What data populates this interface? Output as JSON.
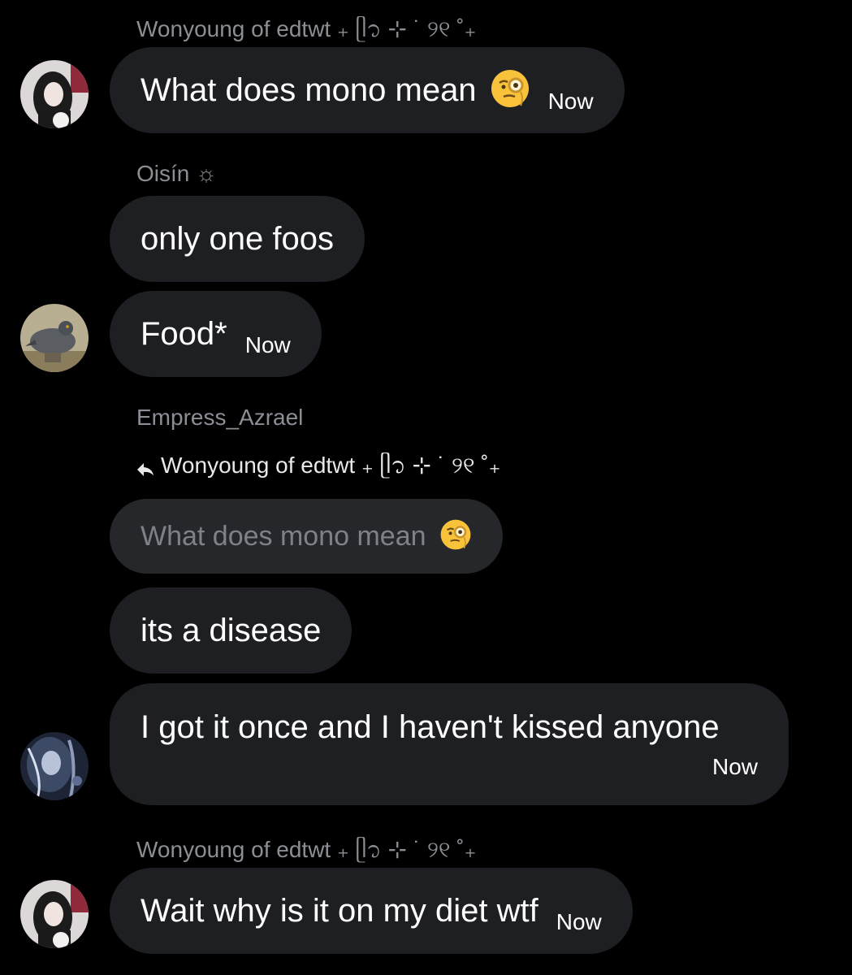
{
  "messages": [
    {
      "sender": "Wonyoung of edtwt ₊ ᥫ᭡ ⊹ ˙ ୨୧ ˚₊",
      "text": "What does mono mean",
      "time": "Now"
    },
    {
      "sender": "Oisín ☼",
      "text": "only one foos"
    },
    {
      "text": "Food*",
      "time": "Now"
    },
    {
      "sender": "Empress_Azrael",
      "reply_to": "Wonyoung of edtwt ₊ ᥫ᭡ ⊹ ˙ ୨୧ ˚₊",
      "quoted_text": "What does mono mean"
    },
    {
      "text": "its a disease"
    },
    {
      "text": "I got it once and I haven't kissed anyone",
      "time": "Now"
    },
    {
      "sender": "Wonyoung of edtwt ₊ ᥫ᭡ ⊹ ˙ ୨୧ ˚₊",
      "text": "Wait why is it on my diet wtf",
      "time": "Now"
    }
  ],
  "colors": {
    "background": "#000000",
    "bubble": "#1e1f22",
    "quoted_bubble": "#25272b",
    "sender_text": "#8b8f95"
  },
  "icons": {
    "reply": "reply-arrow-icon",
    "emoji": "face-with-monocle-emoji"
  }
}
